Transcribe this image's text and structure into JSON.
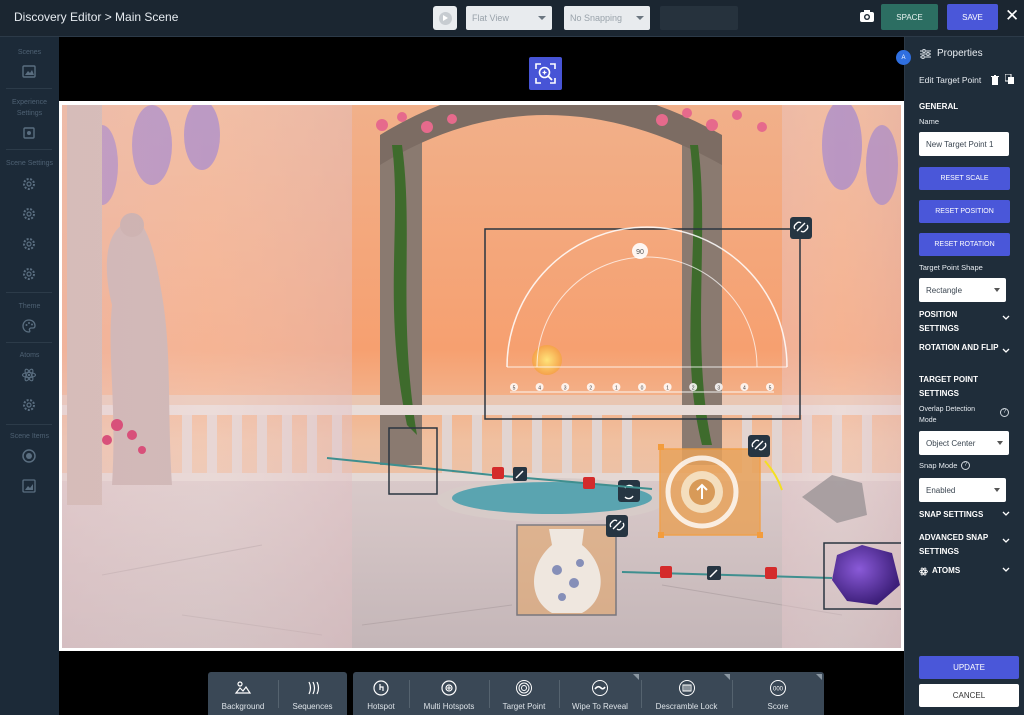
{
  "header": {
    "breadcrumb": "Discovery Editor > Main Scene",
    "view_mode": "Flat View",
    "snapping": "No Snapping",
    "space_label": "SPACE",
    "save_label": "SAVE"
  },
  "sidebar": {
    "scenes": "Scenes",
    "experience_settings_1": "Experience",
    "experience_settings_2": "Settings",
    "scene_settings": "Scene Settings",
    "theme": "Theme",
    "atoms": "Atoms",
    "scene_items": "Scene Items"
  },
  "scene": {
    "protractor_top": "90",
    "ruler_labels": [
      "5",
      "4",
      "3",
      "2",
      "1",
      "0",
      "1",
      "2",
      "3",
      "4",
      "5"
    ]
  },
  "toolbar": {
    "groups": [
      {
        "items": [
          "Background",
          "Sequences"
        ]
      },
      {
        "items": [
          "Hotspot",
          "Multi Hotspots",
          "Target Point",
          "Wipe To Reveal",
          "Descramble Lock",
          "Score"
        ]
      }
    ]
  },
  "properties": {
    "badge": "A",
    "title": "Properties",
    "edit_label": "Edit Target Point",
    "general": "GENERAL",
    "name_label": "Name",
    "name_value": "New Target Point 1",
    "reset_scale": "RESET SCALE",
    "reset_position": "RESET POSITION",
    "reset_rotation": "RESET ROTATION",
    "shape_label": "Target Point Shape",
    "shape_value": "Rectangle",
    "position_settings": "POSITION SETTINGS",
    "rotation_flip": "ROTATION AND FLIP",
    "target_settings": "TARGET POINT SETTINGS",
    "overlap_label": "Overlap Detection Mode",
    "overlap_value": "Object Center",
    "snap_mode_label": "Snap Mode",
    "snap_mode_value": "Enabled",
    "snap_settings": "SNAP SETTINGS",
    "advanced_snap": "ADVANCED SNAP SETTINGS",
    "atoms": "ATOMS",
    "update_label": "UPDATE",
    "cancel_label": "CANCEL"
  },
  "colors": {
    "accent": "#4a57d9",
    "space": "#2c6e62",
    "panel": "#1f2d3a",
    "selection": "#f39c3c"
  }
}
